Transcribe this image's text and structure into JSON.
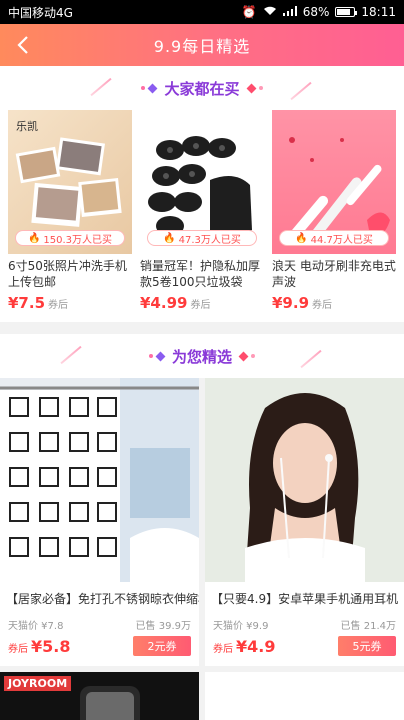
{
  "status": {
    "carrier": "中国移动4G",
    "battery": "68%",
    "time": "18:11"
  },
  "header": {
    "title": "9.9每日精选"
  },
  "section1": {
    "title": "大家都在买",
    "items": [
      {
        "sold": "150.3万人已买",
        "name": "6寸50张照片冲洗手机上传包邮",
        "price": "¥7.5",
        "after": "券后",
        "brand": "乐凯"
      },
      {
        "sold": "47.3万人已买",
        "name": "销量冠军！护隐私加厚款5卷100只垃圾袋",
        "price": "¥4.99",
        "after": "券后"
      },
      {
        "sold": "44.7万人已买",
        "name": "浪天 电动牙刷非充电式声波",
        "price": "¥9.9",
        "after": "券后"
      }
    ]
  },
  "section2": {
    "title": "为您精选",
    "items": [
      {
        "name": "【居家必备】免打孔不锈钢晾衣伸缩杆",
        "orig_label": "天猫价 ¥7.8",
        "sold": "已售 39.9万",
        "after": "券后",
        "price": "¥5.8",
        "coupon": "2元券"
      },
      {
        "name": "【只要4.9】安卓苹果手机通用耳机",
        "orig_label": "天猫价 ¥9.9",
        "sold": "已售 21.4万",
        "after": "券后",
        "price": "¥4.9",
        "coupon": "5元券"
      }
    ],
    "next_brand": "JOYROOM"
  },
  "colors": {
    "accent": "#ff3b3b",
    "header_from": "#ff8a5c",
    "header_to": "#ff5f93",
    "section_title": "#8a3ad8"
  }
}
